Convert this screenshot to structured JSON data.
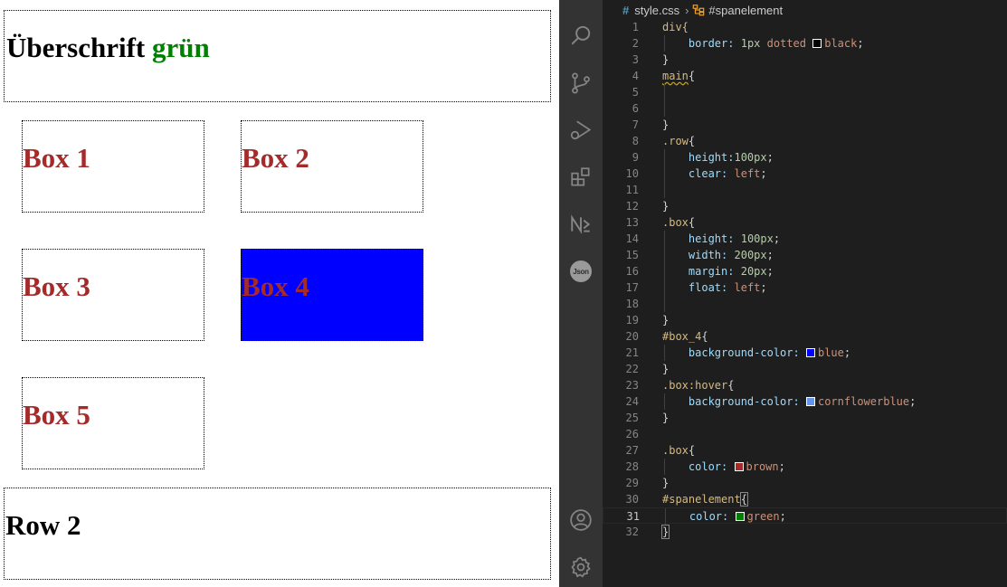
{
  "preview": {
    "heading_text": "Überschrift",
    "heading_span": "grün",
    "boxes": [
      "Box 1",
      "Box 2",
      "Box 3",
      "Box 4",
      "Box 5"
    ],
    "row2_text": "Row 2",
    "colors": {
      "box_text": "#a52a2a",
      "span_text": "#008000",
      "box4_bg": "#0000ff"
    }
  },
  "editor": {
    "breadcrumb": {
      "file": "style.css",
      "symbol": "#spanelement"
    },
    "activity_icons": [
      "search-icon",
      "source-control-icon",
      "run-debug-icon",
      "extensions-icon",
      "nx-console-icon",
      "json-icon",
      "account-icon",
      "settings-gear-icon"
    ],
    "json_badge": "Json",
    "line_numbers": [
      "1",
      "2",
      "3",
      "4",
      "5",
      "6",
      "7",
      "8",
      "9",
      "10",
      "11",
      "12",
      "13",
      "14",
      "15",
      "16",
      "17",
      "18",
      "19",
      "20",
      "21",
      "22",
      "23",
      "24",
      "25",
      "26",
      "27",
      "28",
      "29",
      "30",
      "31",
      "32"
    ],
    "code": {
      "l1": "div{",
      "l2_prop": "border:",
      "l2_num": "1px",
      "l2_v1": "dotted",
      "l2_v2": "black",
      "l2_end": ";",
      "l3": "}",
      "l4_sel": "main",
      "l4_br": "{",
      "l7": "}",
      "l8_sel": ".row",
      "l8_br": "{",
      "l9_prop": "height:",
      "l9_num": "100px",
      "l9_end": ";",
      "l10_prop": "clear:",
      "l10_val": "left",
      "l10_end": ";",
      "l12": "}",
      "l13_sel": ".box",
      "l13_br": "{",
      "l14_prop": "height:",
      "l14_num": "100px",
      "l14_end": ";",
      "l15_prop": "width:",
      "l15_num": "200px",
      "l15_end": ";",
      "l16_prop": "margin:",
      "l16_num": "20px",
      "l16_end": ";",
      "l17_prop": "float:",
      "l17_val": "left",
      "l17_end": ";",
      "l19": "}",
      "l20_sel": "#box_4",
      "l20_br": "{",
      "l21_prop": "background-color:",
      "l21_val": "blue",
      "l21_end": ";",
      "l22": "}",
      "l23_sel": ".box:hover",
      "l23_br": "{",
      "l24_prop": "background-color:",
      "l24_val": "cornflowerblue",
      "l24_end": ";",
      "l25": "}",
      "l27_sel": ".box",
      "l27_br": "{",
      "l28_prop": "color:",
      "l28_val": "brown",
      "l28_end": ";",
      "l29": "}",
      "l30_sel": "#spanelement",
      "l30_br": "{",
      "l31_prop": "color:",
      "l31_val": "green",
      "l31_end": ";",
      "l32": "}"
    },
    "swatch_colors": {
      "black": "#000000",
      "blue": "#0000ff",
      "cornflowerblue": "#6495ed",
      "brown": "#a52a2a",
      "green": "#008000"
    }
  }
}
